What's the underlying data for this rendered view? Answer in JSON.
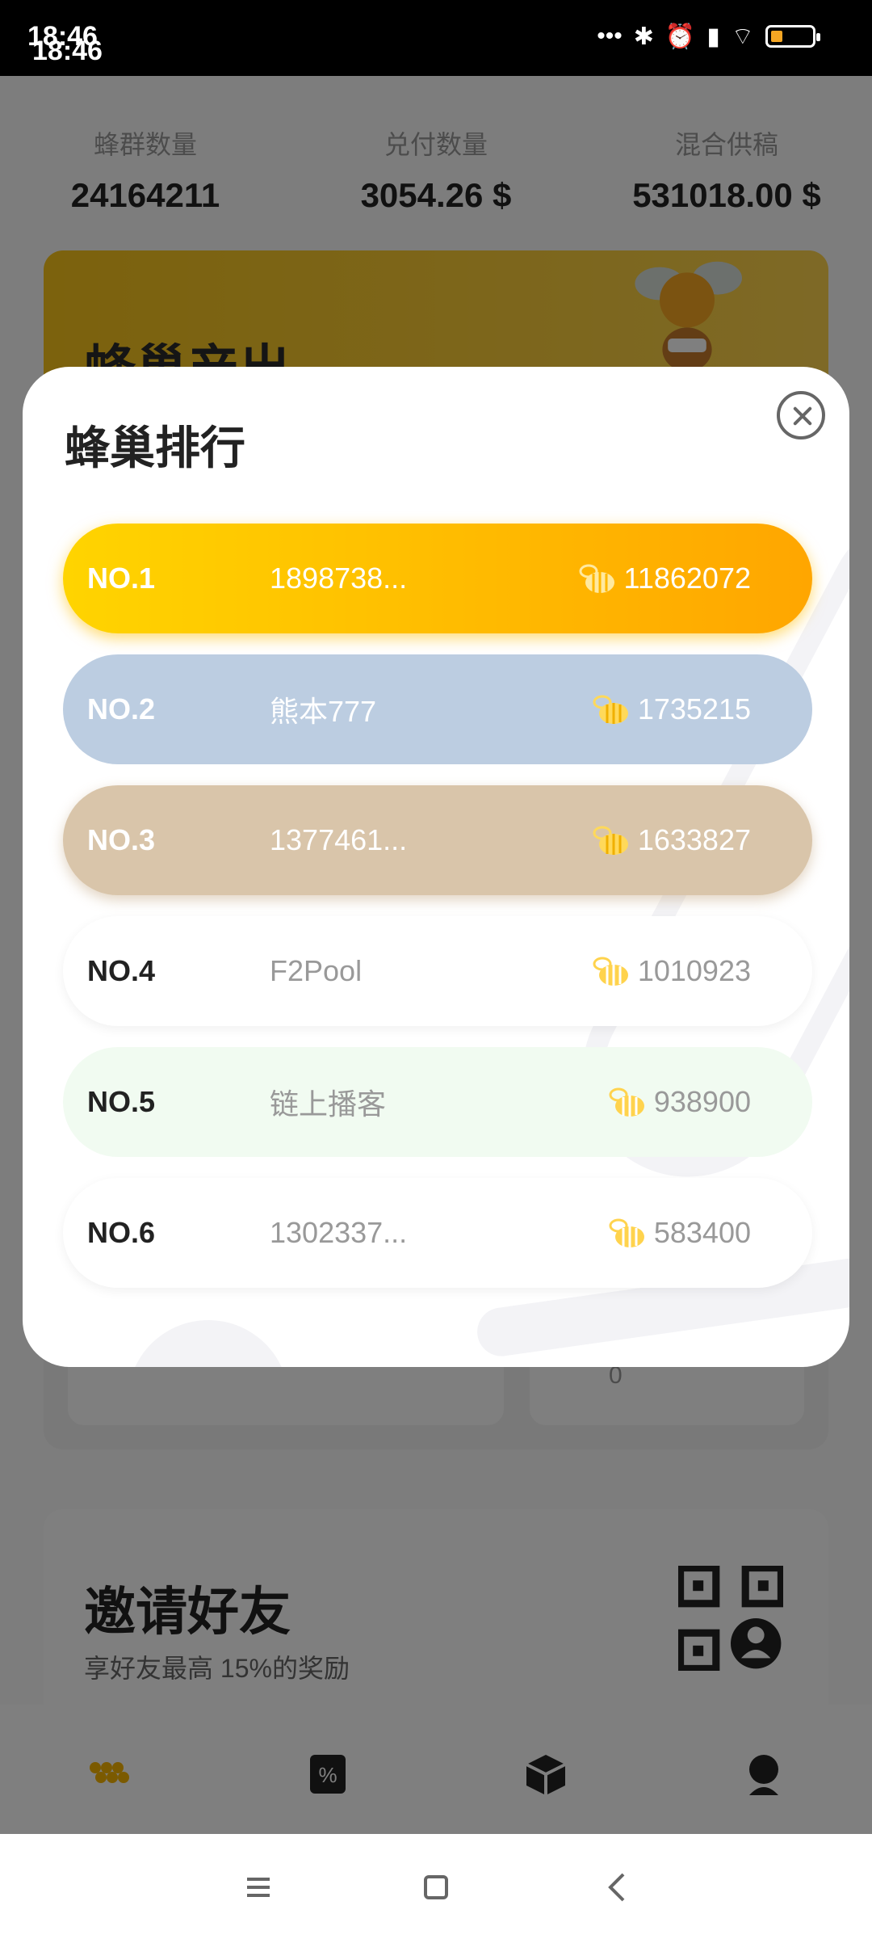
{
  "status_bar": {
    "time": "18:46",
    "time_shadow": "18:46",
    "icons": [
      "more-dots-icon",
      "bluetooth-icon",
      "alarm-icon",
      "signal-icon",
      "wifi-icon",
      "battery-icon"
    ]
  },
  "stats": [
    {
      "label": "蜂群数量",
      "value": "24164211"
    },
    {
      "label": "兑付数量",
      "value": "3054.26 $"
    },
    {
      "label": "混合供稿",
      "value": "531018.00 $"
    }
  ],
  "banner": {
    "title": "蜂巢产出"
  },
  "background_card": {
    "coin_value": "0"
  },
  "invite": {
    "title": "邀请好友",
    "subtitle": "享好友最高 15%的奖励"
  },
  "modal": {
    "title": "蜂巢排行",
    "ranks": [
      {
        "no": "NO.1",
        "name": "1898738...",
        "score": "11862072"
      },
      {
        "no": "NO.2",
        "name": "熊本777",
        "score": "1735215"
      },
      {
        "no": "NO.3",
        "name": "1377461...",
        "score": "1633827"
      },
      {
        "no": "NO.4",
        "name": "F2Pool",
        "score": "1010923"
      },
      {
        "no": "NO.5",
        "name": "链上播客",
        "score": "938900"
      },
      {
        "no": "NO.6",
        "name": "1302337...",
        "score": "583400"
      }
    ]
  },
  "colors": {
    "accent": "#FFB800",
    "rank1": "#FFC400",
    "rank2": "#BCCDE1",
    "rank3": "#D9C5AA",
    "rank5": "#F1FBF1"
  }
}
